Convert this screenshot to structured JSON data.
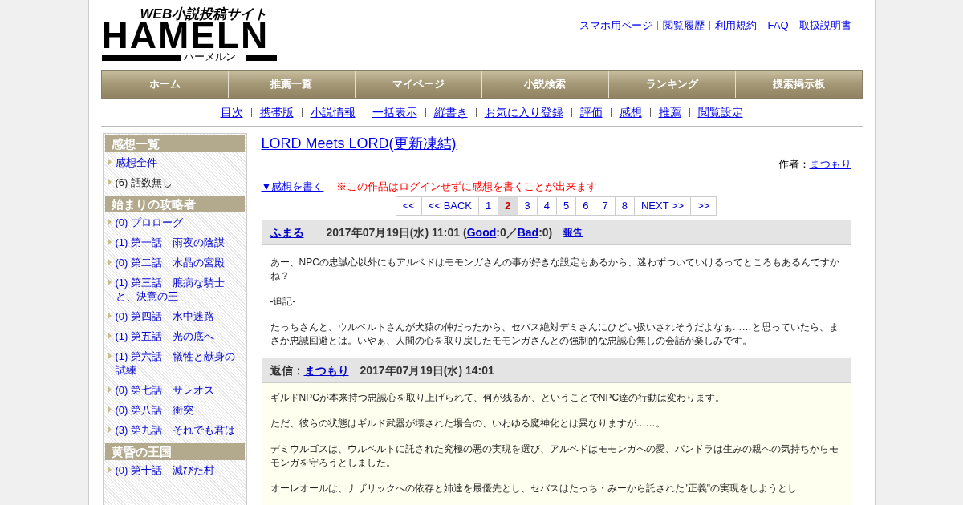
{
  "logo": {
    "tagline": "WEB小説投稿サイト",
    "name": "HAMELN",
    "kana": "ハーメルン"
  },
  "top_links": [
    "スマホ用ページ",
    "閲覧履歴",
    "利用規約",
    "FAQ",
    "取扱説明書"
  ],
  "nav": [
    "ホーム",
    "推薦一覧",
    "マイページ",
    "小説検索",
    "ランキング",
    "捜索掲示板"
  ],
  "sub_nav": [
    "目次",
    "携帯版",
    "小説情報",
    "一括表示",
    "縦書き",
    "お気に入り登録",
    "評価",
    "感想",
    "推薦",
    "閲覧設定"
  ],
  "sidebar": [
    {
      "title": "感想一覧",
      "items": [
        {
          "kind": "link",
          "label": "感想全件"
        },
        {
          "kind": "text",
          "label": "(6) 話数無し"
        }
      ]
    },
    {
      "title": "始まりの攻略者",
      "items": [
        {
          "kind": "link",
          "label": "(0) プロローグ"
        },
        {
          "kind": "link",
          "label": "(1) 第一話　雨夜の陰謀"
        },
        {
          "kind": "link",
          "label": "(0) 第二話　水晶の宮殿"
        },
        {
          "kind": "link",
          "label": "(1) 第三話　臆病な騎士と、決意の王"
        },
        {
          "kind": "link",
          "label": "(0) 第四話　水中迷路"
        },
        {
          "kind": "link",
          "label": "(1) 第五話　光の底へ"
        },
        {
          "kind": "link",
          "label": "(1) 第六話　犠牲と献身の試練"
        },
        {
          "kind": "link",
          "label": "(0) 第七話　サレオス"
        },
        {
          "kind": "link",
          "label": "(0) 第八話　衝突"
        },
        {
          "kind": "link",
          "label": "(3) 第九話　それでも君は"
        }
      ]
    },
    {
      "title": "黄昏の王国",
      "items": [
        {
          "kind": "link",
          "label": "(0) 第十話　滅びた村"
        }
      ]
    }
  ],
  "novel": {
    "title": "LORD Meets LORD(更新凍結)",
    "author_label": "作者：",
    "author": "まつもり"
  },
  "write_link": "▼感想を書く",
  "notice": "※この作品はログインせずに感想を書くことが出来ます",
  "pagination": [
    {
      "label": "<<",
      "selected": false
    },
    {
      "label": "<< BACK",
      "selected": false
    },
    {
      "label": "1",
      "selected": false
    },
    {
      "label": "2",
      "selected": true
    },
    {
      "label": "3",
      "selected": false
    },
    {
      "label": "4",
      "selected": false
    },
    {
      "label": "5",
      "selected": false
    },
    {
      "label": "6",
      "selected": false
    },
    {
      "label": "7",
      "selected": false
    },
    {
      "label": "8",
      "selected": false
    },
    {
      "label": "NEXT >>",
      "selected": false
    },
    {
      "label": ">>",
      "selected": false
    }
  ],
  "comment": {
    "author": "ふまる",
    "date": "2017年07月19日(水) 11:01",
    "paren": "(",
    "good_label": "Good",
    "good": ":0／",
    "bad_label": "Bad",
    "bad": ":0)",
    "report": "報告",
    "paragraphs": [
      "あー、NPCの忠誠心以外にもアルベドはモモンガさんの事が好きな設定もあるから、迷わずついていけるってところもあるんですかね？",
      "-追記-",
      "たっちさんと、ウルベルトさんが犬猿の仲だったから、セバス絶対デミさんにひどい扱いされそうだよなぁ……と思っていたら、まさか忠誠回避とは。いやぁ、人間の心を取り戻したモモンガさんとの強制的な忠誠心無しの会話が楽しみです。"
    ]
  },
  "reply": {
    "label": "返信：",
    "author": "まつもり",
    "date": "2017年07月19日(水) 14:01",
    "paragraphs": [
      "ギルドNPCが本来持つ忠誠心を取り上げられて、何が残るか、ということでNPC達の行動は変わります。",
      "ただ、彼らの状態はギルド武器が壊された場合の、いわゆる魔神化とは異なりますが……。",
      "デミウルゴスは、ウルベルトに託された究極の悪の実現を選び、アルベドはモモンガへの愛、パンドラは生みの親への気持ちからモモンガを守ろうとしました。",
      "オーレオールは、ナザリックへの依存と姉達を最優先とし、セバスはたっち・みーから託された\"正義\"の実現をしようとし"
    ]
  }
}
